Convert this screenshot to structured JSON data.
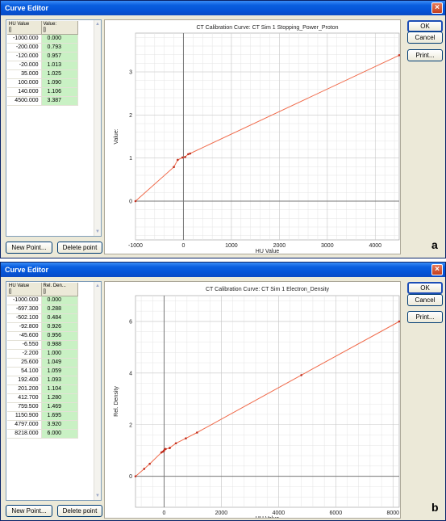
{
  "windows": [
    {
      "title": "Curve Editor",
      "close_icon": "×",
      "table": {
        "col1_header": "HU Value",
        "col1_unit": "[]",
        "col2_header": "Value:",
        "col2_unit": "[]",
        "rows": [
          [
            "-1000.000",
            "0.000"
          ],
          [
            "-200.000",
            "0.793"
          ],
          [
            "-120.000",
            "0.957"
          ],
          [
            "-20.000",
            "1.013"
          ],
          [
            "35.000",
            "1.025"
          ],
          [
            "100.000",
            "1.090"
          ],
          [
            "140.000",
            "1.106"
          ],
          [
            "4500.000",
            "3.387"
          ]
        ]
      },
      "buttons": {
        "new_point": "New Point...",
        "delete_point": "Delete point",
        "ok": "OK",
        "cancel": "Cancel",
        "print": "Print..."
      },
      "panel_label": "a"
    },
    {
      "title": "Curve Editor",
      "close_icon": "×",
      "table": {
        "col1_header": "HU Value",
        "col1_unit": "[]",
        "col2_header": "Rel. Den...",
        "col2_unit": "[]",
        "rows": [
          [
            "-1000.000",
            "0.000"
          ],
          [
            "-697.300",
            "0.288"
          ],
          [
            "-502.100",
            "0.484"
          ],
          [
            "-92.800",
            "0.926"
          ],
          [
            "-45.600",
            "0.956"
          ],
          [
            "-6.550",
            "0.988"
          ],
          [
            "-2.200",
            "1.000"
          ],
          [
            "25.600",
            "1.049"
          ],
          [
            "54.100",
            "1.059"
          ],
          [
            "192.400",
            "1.093"
          ],
          [
            "201.200",
            "1.104"
          ],
          [
            "412.700",
            "1.280"
          ],
          [
            "759.500",
            "1.469"
          ],
          [
            "1150.900",
            "1.695"
          ],
          [
            "4797.000",
            "3.920"
          ],
          [
            "8218.000",
            "6.000"
          ]
        ]
      },
      "buttons": {
        "new_point": "New Point...",
        "delete_point": "Delete point",
        "ok": "OK",
        "cancel": "Cancel",
        "print": "Print..."
      },
      "panel_label": "b"
    }
  ],
  "chart_data": [
    {
      "type": "line",
      "title": "CT Calibration Curve: CT Sim 1 Stopping_Power_Proton",
      "xlabel": "HU Value",
      "ylabel": "Value:",
      "xlim": [
        -1000,
        4500
      ],
      "ylim": [
        -0.9,
        3.9
      ],
      "xticks": [
        -1000,
        0,
        1000,
        2000,
        3000,
        4000
      ],
      "yticks": [
        0,
        1,
        2,
        3
      ],
      "grid": true,
      "line_color": "#f06a4a",
      "series": [
        {
          "x": [
            -1000,
            -200,
            -120,
            -20,
            35,
            100,
            140,
            4500
          ],
          "y": [
            0.0,
            0.793,
            0.957,
            1.013,
            1.025,
            1.09,
            1.106,
            3.387
          ]
        }
      ]
    },
    {
      "type": "line",
      "title": "CT Calibration Curve: CT Sim 1 Electron_Density",
      "xlabel": "HU Value",
      "ylabel": "Rel. Density",
      "xlim": [
        -1000,
        8218
      ],
      "ylim": [
        -1.2,
        7.0
      ],
      "xticks": [
        0,
        2000,
        4000,
        6000,
        8000
      ],
      "yticks": [
        0,
        2,
        4,
        6
      ],
      "grid": true,
      "line_color": "#f06a4a",
      "series": [
        {
          "x": [
            -1000,
            -697.3,
            -502.1,
            -92.8,
            -45.6,
            -6.55,
            -2.2,
            25.6,
            54.1,
            192.4,
            201.2,
            412.7,
            759.5,
            1150.9,
            4797,
            8218
          ],
          "y": [
            0.0,
            0.288,
            0.484,
            0.926,
            0.956,
            0.988,
            1.0,
            1.049,
            1.059,
            1.093,
            1.104,
            1.28,
            1.469,
            1.695,
            3.92,
            6.0
          ]
        }
      ]
    }
  ]
}
